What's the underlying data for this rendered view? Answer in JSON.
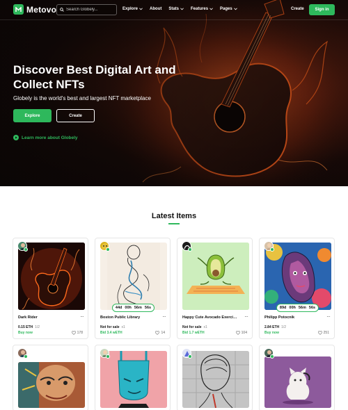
{
  "nav": {
    "logo_text": "Metovo",
    "search_placeholder": "Search Globely...",
    "menu": [
      {
        "label": "Explore",
        "dropdown": true
      },
      {
        "label": "About",
        "dropdown": false
      },
      {
        "label": "Stats",
        "dropdown": true
      },
      {
        "label": "Features",
        "dropdown": true
      },
      {
        "label": "Pages",
        "dropdown": true
      }
    ],
    "create_label": "Create",
    "signin_label": "Sign in"
  },
  "hero": {
    "title": "Discover Best Digital Art and Collect NFTs",
    "subtitle": "Globely is the world's best and largest NFT marketplace",
    "explore_label": "Explore",
    "create_label": "Create",
    "learn_more": "Learn more about Globely"
  },
  "section": {
    "title": "Latest Items"
  },
  "items": [
    {
      "name": "Dark Rider",
      "price": "0.15 ETH",
      "qty": "1/2",
      "action": "Buy now",
      "likes": "178",
      "timer": null
    },
    {
      "name": "Boston Public Library",
      "price": "Not for sale",
      "qty": "x1",
      "action": "Bid 3.4 wETH",
      "likes": "14",
      "timer": [
        "44d",
        "00h",
        "56m",
        "56s"
      ]
    },
    {
      "name": "Happy Cute Avocado Exercising",
      "price": "Not for sale",
      "qty": "x1",
      "action": "Bid 1.7 wETH",
      "likes": "104",
      "timer": null
    },
    {
      "name": "Philipp Potocnik",
      "price": "2.84 ETH",
      "qty": "1/2",
      "action": "Buy now",
      "likes": "251",
      "timer": [
        "89d",
        "00h",
        "56m",
        "56s"
      ]
    }
  ],
  "colors": {
    "accent": "#2eb85c",
    "hero_dark": "#0b0605",
    "flame": "#e85d1a"
  }
}
